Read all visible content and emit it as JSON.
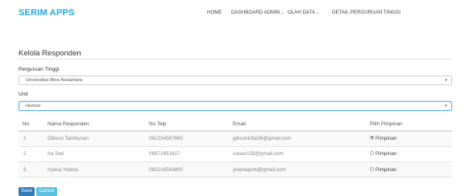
{
  "app": {
    "brand": "SERIM APPS"
  },
  "nav": {
    "items": [
      {
        "label": "HOME",
        "dropdown": false
      },
      {
        "label": "DASHBOARD ADMIN",
        "dropdown": true
      },
      {
        "label": "OLAH DATA",
        "dropdown": true
      },
      {
        "label": "DETAIL PERGURUAN TINGGI",
        "dropdown": false
      }
    ]
  },
  "page": {
    "title": "Kelola Responden"
  },
  "form": {
    "perguruan_label": "Perguruan Tinggi",
    "perguruan_value": "Universitas Bina Nusantara",
    "unit_label": "Unit",
    "unit_value": "Humas"
  },
  "table": {
    "headers": [
      "No",
      "Nama Responden",
      "No Telp",
      "Email",
      "Pilih Pimpinan"
    ],
    "rows": [
      {
        "no": "1",
        "name": "Gibson Tambunan",
        "phone": "081234567890",
        "email": "gibsontrifai36@gmail.com",
        "option": "Pimpinan",
        "selected": true
      },
      {
        "no": "2",
        "name": "Ira Sari",
        "phone": "08971851817",
        "email": "irasari158@gmail.com",
        "option": "Pimpinan",
        "selected": false
      },
      {
        "no": "3",
        "name": "Iryasa Yolana",
        "phone": "082216543800",
        "email": "yolanaputri@gmail.com",
        "option": "Pimpinan",
        "selected": false
      }
    ]
  },
  "actions": {
    "save": "Save",
    "cancel": "Cancel"
  },
  "colors": {
    "brand": "#2aa7e0",
    "save": "#337ab7",
    "cancel": "#5bc0de",
    "striped_row": "#f9f9f9"
  }
}
